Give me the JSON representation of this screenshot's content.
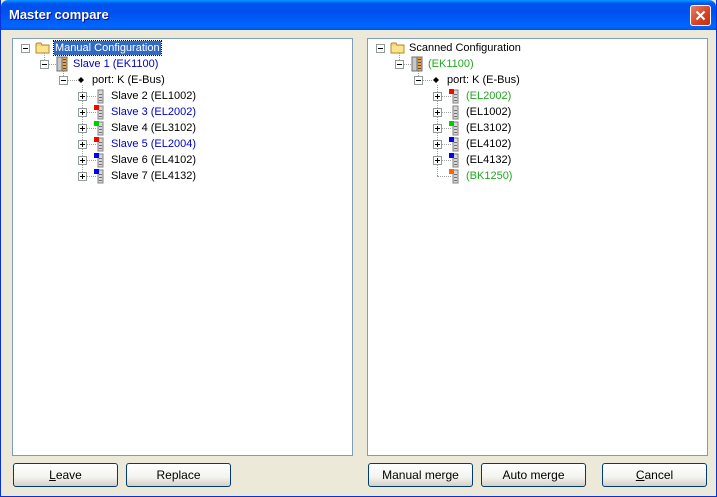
{
  "window": {
    "title": "Master compare"
  },
  "colors": {
    "blue_text": "#0000c8",
    "green_text": "#21a821",
    "black_text": "#000000"
  },
  "left_tree": [
    {
      "label": "Manual Configuration",
      "level": 0,
      "icon": "folder-icon",
      "expander": "minus",
      "color": "black",
      "selected": true
    },
    {
      "label": "Slave 1 (EK1100)",
      "level": 1,
      "icon": "coupler-icon",
      "expander": "minus",
      "color": "blue"
    },
    {
      "label": "port: K (E-Bus)",
      "level": 2,
      "icon": "port-icon",
      "expander": "minus",
      "color": "black"
    },
    {
      "label": "Slave 2 (EL1002)",
      "level": 3,
      "icon": "terminal-gray-icon",
      "expander": "plus",
      "color": "black"
    },
    {
      "label": "Slave 3 (EL2002)",
      "level": 3,
      "icon": "terminal-red-icon",
      "expander": "plus",
      "color": "blue"
    },
    {
      "label": "Slave 4 (EL3102)",
      "level": 3,
      "icon": "terminal-green-icon",
      "expander": "plus",
      "color": "black"
    },
    {
      "label": "Slave 5 (EL2004)",
      "level": 3,
      "icon": "terminal-red-icon",
      "expander": "plus",
      "color": "blue"
    },
    {
      "label": "Slave 6 (EL4102)",
      "level": 3,
      "icon": "terminal-blue-icon",
      "expander": "plus",
      "color": "black"
    },
    {
      "label": "Slave 7 (EL4132)",
      "level": 3,
      "icon": "terminal-blue-icon",
      "expander": "plus",
      "color": "black"
    }
  ],
  "right_tree": [
    {
      "label": "Scanned Configuration",
      "level": 0,
      "icon": "folder-icon",
      "expander": "minus",
      "color": "black"
    },
    {
      "label": "(EK1100)",
      "level": 1,
      "icon": "coupler-icon",
      "expander": "minus",
      "color": "green"
    },
    {
      "label": "port: K (E-Bus)",
      "level": 2,
      "icon": "port-icon",
      "expander": "minus",
      "color": "black"
    },
    {
      "label": "(EL2002)",
      "level": 3,
      "icon": "terminal-red-icon",
      "expander": "plus",
      "color": "green"
    },
    {
      "label": "(EL1002)",
      "level": 3,
      "icon": "terminal-gray-icon",
      "expander": "plus",
      "color": "black"
    },
    {
      "label": "(EL3102)",
      "level": 3,
      "icon": "terminal-green-icon",
      "expander": "plus",
      "color": "black"
    },
    {
      "label": "(EL4102)",
      "level": 3,
      "icon": "terminal-blue-icon",
      "expander": "plus",
      "color": "black"
    },
    {
      "label": "(EL4132)",
      "level": 3,
      "icon": "terminal-blue-icon",
      "expander": "plus",
      "color": "black"
    },
    {
      "label": "(BK1250)",
      "level": 3,
      "icon": "terminal-orange-icon",
      "expander": "none",
      "color": "green"
    }
  ],
  "buttons": {
    "leave": {
      "label": "Leave",
      "underline": "L"
    },
    "replace": {
      "label": "Replace"
    },
    "manual_merge": {
      "label": "Manual merge"
    },
    "auto_merge": {
      "label": "Auto merge"
    },
    "cancel": {
      "label": "Cancel",
      "underline": "C"
    }
  }
}
